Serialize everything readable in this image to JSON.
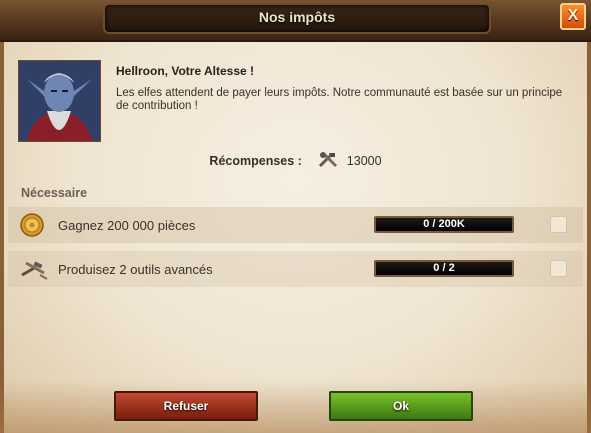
{
  "dialog": {
    "title": "Nos impôts",
    "close_label": "X"
  },
  "quest": {
    "speaker": "Hellroon, Votre Altesse !",
    "message": "Les elfes attendent de payer leurs impôts. Notre communauté est basée sur un principe de contribution !"
  },
  "rewards": {
    "label": "Récompenses :",
    "value": "13000",
    "icon": "tools-icon"
  },
  "requirements": {
    "heading": "Nécessaire",
    "items": [
      {
        "icon": "coin-icon",
        "label": "Gagnez 200 000 pièces",
        "progress_text": "0 / 200K",
        "progress": 0,
        "checked": false
      },
      {
        "icon": "advanced-tools-icon",
        "label": "Produisez 2 outils avancés",
        "progress_text": "0 / 2",
        "progress": 0,
        "checked": false
      }
    ]
  },
  "buttons": {
    "refuse": "Refuser",
    "ok": "Ok"
  },
  "colors": {
    "refuse": "#a83a22",
    "ok": "#5aa21e",
    "close": "#f07020"
  }
}
